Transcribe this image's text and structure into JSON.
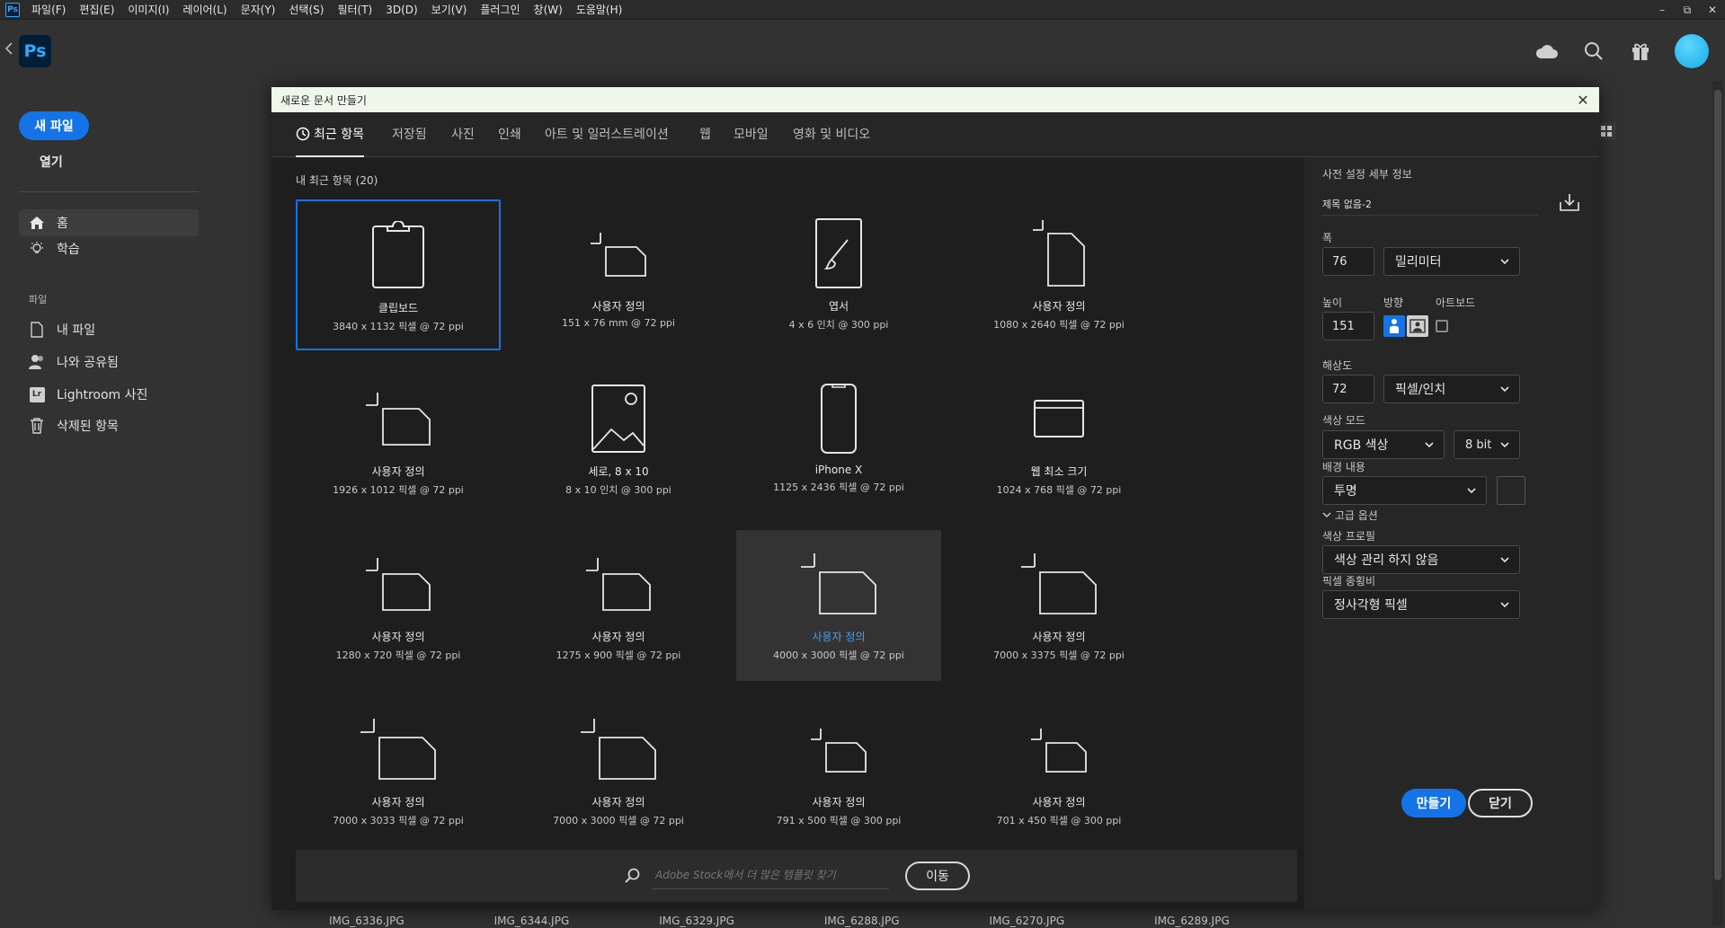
{
  "menubar": {
    "app_badge": "Ps",
    "items": [
      "파일(F)",
      "편집(E)",
      "이미지(I)",
      "레이어(L)",
      "문자(Y)",
      "선택(S)",
      "필터(T)",
      "3D(D)",
      "보기(V)",
      "플러그인",
      "창(W)",
      "도움말(H)"
    ],
    "window_controls": [
      "–",
      "⧉",
      "✕"
    ]
  },
  "appbar": {
    "logo": "Ps"
  },
  "leftnav": {
    "new_file": "새 파일",
    "open": "열기",
    "home": "홈",
    "learn": "학습",
    "files_section": "파일",
    "my_files": "내 파일",
    "shared": "나와 공유됨",
    "lightroom": "Lightroom 사진",
    "deleted": "삭제된 항목",
    "lr_badge": "Lr"
  },
  "background": {
    "file_names": [
      "IMG_6336.JPG",
      "IMG_6344.JPG",
      "IMG_6329.JPG",
      "IMG_6288.JPG",
      "IMG_6270.JPG",
      "IMG_6289.JPG"
    ]
  },
  "dialog": {
    "title": "새로운 문서 만들기",
    "close": "✕",
    "tabs": [
      "최근 항목",
      "저장됨",
      "사진",
      "인쇄",
      "아트 및 일러스트레이션",
      "웹",
      "모바일",
      "영화 및 비디오"
    ],
    "recent_label": "내 최근 항목",
    "recent_count": "(20)",
    "presets": [
      {
        "name": "클립보드",
        "dims": "3840 x 1132 픽셀 @ 72 ppi",
        "icon": "clipboard-icon"
      },
      {
        "name": "사용자 정의",
        "dims": "151 x 76 mm @ 72 ppi",
        "icon": "custom-doc-icon"
      },
      {
        "name": "엽서",
        "dims": "4 x 6 인치 @ 300 ppi",
        "icon": "postcard-brush-icon"
      },
      {
        "name": "사용자 정의",
        "dims": "1080 x 2640 픽셀 @ 72 ppi",
        "icon": "custom-doc-icon"
      },
      {
        "name": "사용자 정의",
        "dims": "1926 x 1012 픽셀 @ 72 ppi",
        "icon": "custom-doc-icon"
      },
      {
        "name": "세로, 8 x 10",
        "dims": "8 x 10 인치 @ 300 ppi",
        "icon": "photo-icon"
      },
      {
        "name": "iPhone X",
        "dims": "1125 x 2436 픽셀 @ 72 ppi",
        "icon": "phone-icon"
      },
      {
        "name": "웹 최소 크기",
        "dims": "1024 x 768 픽셀 @ 72 ppi",
        "icon": "browser-icon"
      },
      {
        "name": "사용자 정의",
        "dims": "1280 x 720 픽셀 @ 72 ppi",
        "icon": "custom-doc-icon"
      },
      {
        "name": "사용자 정의",
        "dims": "1275 x 900 픽셀 @ 72 ppi",
        "icon": "custom-doc-icon"
      },
      {
        "name": "사용자 정의",
        "dims": "4000 x 3000 픽셀 @ 72 ppi",
        "icon": "custom-doc-icon"
      },
      {
        "name": "사용자 정의",
        "dims": "7000 x 3375 픽셀 @ 72 ppi",
        "icon": "custom-doc-icon"
      },
      {
        "name": "사용자 정의",
        "dims": "7000 x 3033 픽셀 @ 72 ppi",
        "icon": "custom-doc-icon"
      },
      {
        "name": "사용자 정의",
        "dims": "7000 x 3000 픽셀 @ 72 ppi",
        "icon": "custom-doc-icon"
      },
      {
        "name": "사용자 정의",
        "dims": "791 x 500 픽셀 @ 300 ppi",
        "icon": "custom-doc-icon"
      },
      {
        "name": "사용자 정의",
        "dims": "701 x 450 픽셀 @ 300 ppi",
        "icon": "custom-doc-icon"
      }
    ],
    "stock_search": {
      "placeholder": "Adobe Stock에서 더 많은 템플릿 찾기",
      "go": "이동"
    }
  },
  "details": {
    "header": "사전 설정 세부 정보",
    "doc_name": "제목 없음-2",
    "width_label": "폭",
    "width_value": "76",
    "width_unit": "밀리미터",
    "height_label": "높이",
    "height_value": "151",
    "orientation_label": "방향",
    "artboard_label": "아트보드",
    "resolution_label": "해상도",
    "resolution_value": "72",
    "resolution_unit": "픽셀/인치",
    "color_mode_label": "색상 모드",
    "color_mode": "RGB 색상",
    "bit_depth": "8 bit",
    "background_label": "배경 내용",
    "background": "투명",
    "advanced": "고급 옵션",
    "profile_label": "색상 프로필",
    "profile": "색상 관리 하지 않음",
    "pixel_aspect_label": "픽셀 종횡비",
    "pixel_aspect": "정사각형 픽셀",
    "create": "만들기",
    "close": "닫기"
  },
  "colors": {
    "accent": "#1473e6",
    "hover_text": "#4a9eea",
    "titlebar": "#eef7ea"
  }
}
